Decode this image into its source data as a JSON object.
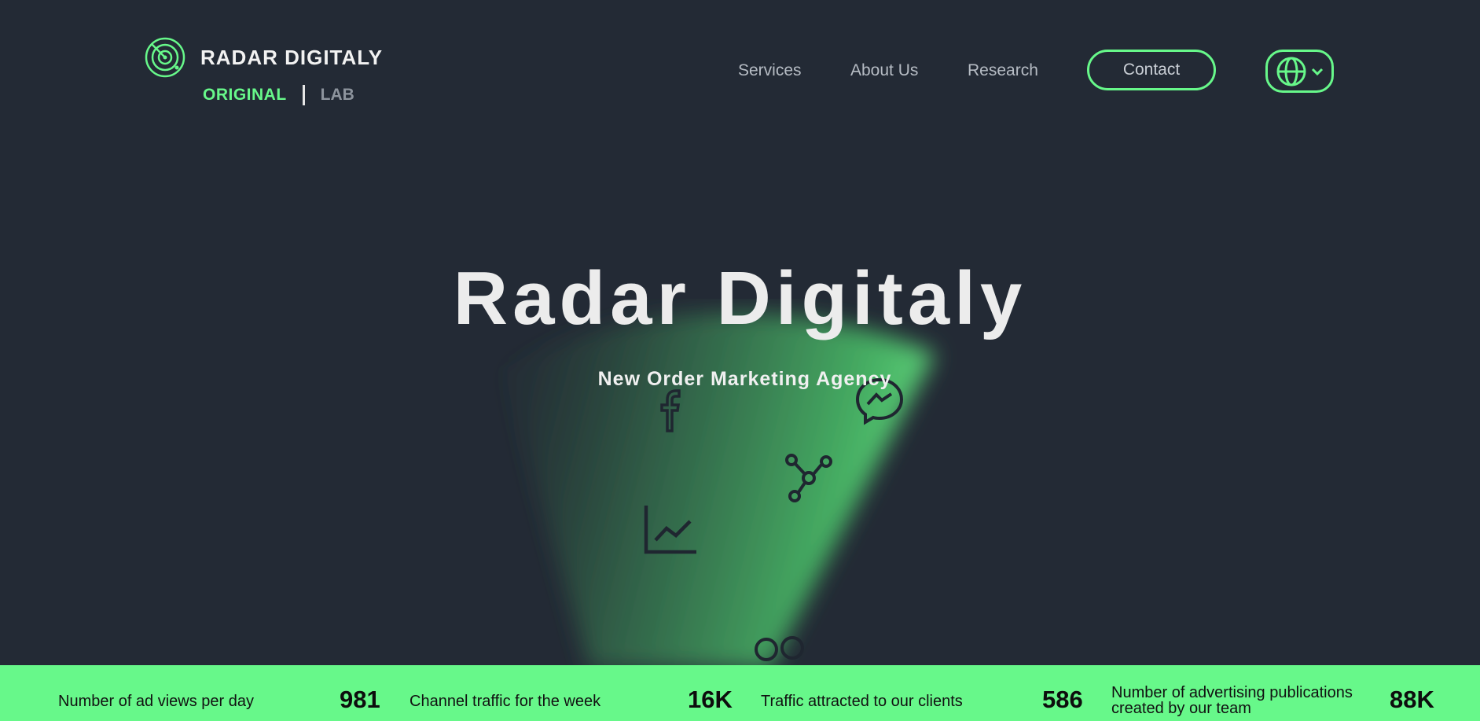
{
  "brand": {
    "name": "RADAR DIGITALY",
    "logo_icon": "radar-icon",
    "accent_color": "#67f88a",
    "background_color": "#232a35"
  },
  "mode_switch": {
    "original_label": "ORIGINAL",
    "lab_label": "LAB"
  },
  "nav": {
    "items": [
      {
        "label": "Services"
      },
      {
        "label": "About Us"
      },
      {
        "label": "Research"
      }
    ],
    "contact_label": "Contact",
    "language_icon": "globe-icon"
  },
  "hero": {
    "title": "Radar Digitaly",
    "subtitle": "New Order Marketing Agency",
    "decorative_icons": [
      "facebook-icon",
      "messenger-icon",
      "network-icon",
      "line-chart-icon",
      "flickr-icon"
    ]
  },
  "stats": [
    {
      "label": "Number of ad views per day",
      "value": "981"
    },
    {
      "label": "Channel traffic for the week",
      "value": "16K"
    },
    {
      "label": "Traffic attracted to our clients",
      "value": "586"
    },
    {
      "label": "Number of advertising publications created by our team",
      "value": "88K"
    }
  ]
}
